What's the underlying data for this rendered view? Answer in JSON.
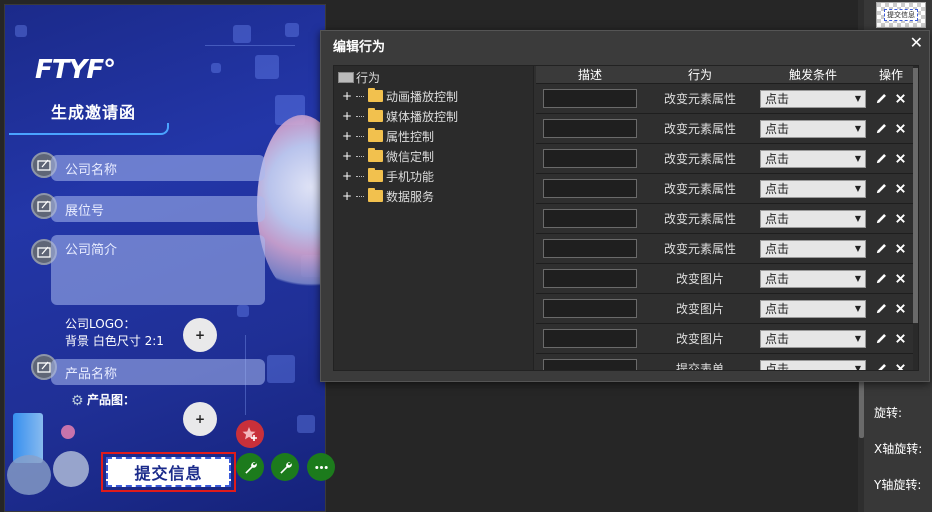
{
  "phone": {
    "logo": "FTYF°",
    "title": "生成邀请函",
    "fields": {
      "company_name": "公司名称",
      "booth_no": "展位号",
      "company_intro": "公司简介",
      "product_name": "产品名称"
    },
    "logo_label_line1": "公司LOGO：",
    "logo_label_line2": "背景 白色尺寸 2:1",
    "product_image_label": "产品图：",
    "plus": "+",
    "submit_label": "提交信息"
  },
  "right_panel": {
    "thumb_label": "提交信息",
    "rotate": "旋转:",
    "x_rotate": "X轴旋转:",
    "y_rotate": "Y轴旋转:"
  },
  "modal": {
    "title": "编辑行为",
    "close": "✕",
    "tree": {
      "root": "行为",
      "items": [
        "动画播放控制",
        "媒体播放控制",
        "属性控制",
        "微信定制",
        "手机功能",
        "数据服务"
      ]
    },
    "table": {
      "headers": {
        "desc": "描述",
        "action": "行为",
        "trigger": "触发条件",
        "ops": "操作"
      },
      "rows": [
        {
          "action": "改变元素属性",
          "trigger": "点击"
        },
        {
          "action": "改变元素属性",
          "trigger": "点击"
        },
        {
          "action": "改变元素属性",
          "trigger": "点击"
        },
        {
          "action": "改变元素属性",
          "trigger": "点击"
        },
        {
          "action": "改变元素属性",
          "trigger": "点击"
        },
        {
          "action": "改变元素属性",
          "trigger": "点击"
        },
        {
          "action": "改变图片",
          "trigger": "点击"
        },
        {
          "action": "改变图片",
          "trigger": "点击"
        },
        {
          "action": "改变图片",
          "trigger": "点击"
        },
        {
          "action": "提交表单",
          "trigger": "点击"
        }
      ]
    }
  },
  "colors": {
    "accent_red": "#e01b1b",
    "accent_green": "#1c7b1c",
    "folder": "#f2c14e"
  }
}
